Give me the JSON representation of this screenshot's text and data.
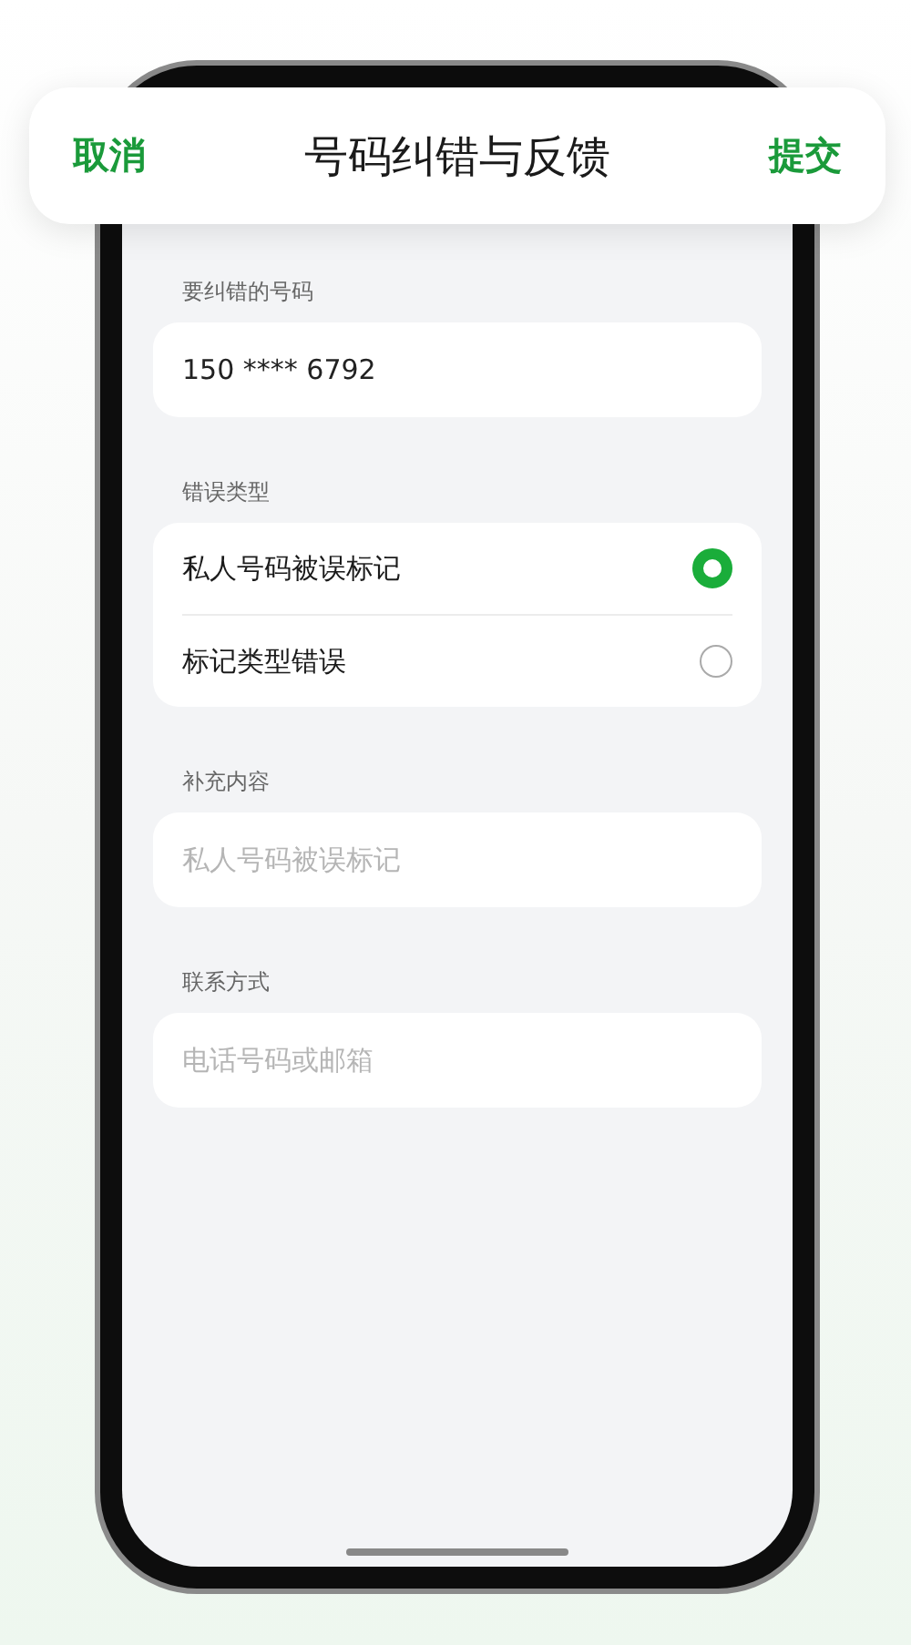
{
  "header": {
    "cancel": "取消",
    "title": "号码纠错与反馈",
    "submit": "提交"
  },
  "sections": [
    {
      "label": "要纠错的号码",
      "kind": "value",
      "value": "150 **** 6792"
    },
    {
      "label": "错误类型",
      "kind": "options",
      "options": [
        {
          "label": "私人号码被误标记",
          "selected": true
        },
        {
          "label": "标记类型错误",
          "selected": false
        }
      ]
    },
    {
      "label": "补充内容",
      "kind": "input",
      "placeholder": "私人号码被误标记"
    },
    {
      "label": "联系方式",
      "kind": "input",
      "placeholder": "电话号码或邮箱"
    }
  ]
}
